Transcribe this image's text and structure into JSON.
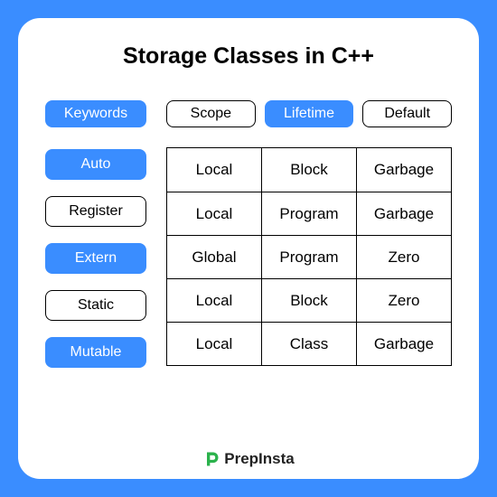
{
  "title": "Storage Classes in C++",
  "keywords_header": {
    "label": "Keywords",
    "highlight": true
  },
  "table_headers": [
    {
      "label": "Scope",
      "highlight": false
    },
    {
      "label": "Lifetime",
      "highlight": true
    },
    {
      "label": "Default",
      "highlight": false
    }
  ],
  "rows": [
    {
      "keyword": "Auto",
      "highlight": true,
      "scope": "Local",
      "lifetime": "Block",
      "default": "Garbage"
    },
    {
      "keyword": "Register",
      "highlight": false,
      "scope": "Local",
      "lifetime": "Program",
      "default": "Garbage"
    },
    {
      "keyword": "Extern",
      "highlight": true,
      "scope": "Global",
      "lifetime": "Program",
      "default": "Zero"
    },
    {
      "keyword": "Static",
      "highlight": false,
      "scope": "Local",
      "lifetime": "Block",
      "default": "Zero"
    },
    {
      "keyword": "Mutable",
      "highlight": true,
      "scope": "Local",
      "lifetime": "Class",
      "default": "Garbage"
    }
  ],
  "brand": "PrepInsta",
  "colors": {
    "accent": "#3a8dff",
    "logo": "#2bb24c"
  },
  "chart_data": {
    "type": "table",
    "title": "Storage Classes in C++",
    "columns": [
      "Keywords",
      "Scope",
      "Lifetime",
      "Default"
    ],
    "rows": [
      [
        "Auto",
        "Local",
        "Block",
        "Garbage"
      ],
      [
        "Register",
        "Local",
        "Program",
        "Garbage"
      ],
      [
        "Extern",
        "Global",
        "Program",
        "Zero"
      ],
      [
        "Static",
        "Local",
        "Block",
        "Zero"
      ],
      [
        "Mutable",
        "Local",
        "Class",
        "Garbage"
      ]
    ]
  }
}
